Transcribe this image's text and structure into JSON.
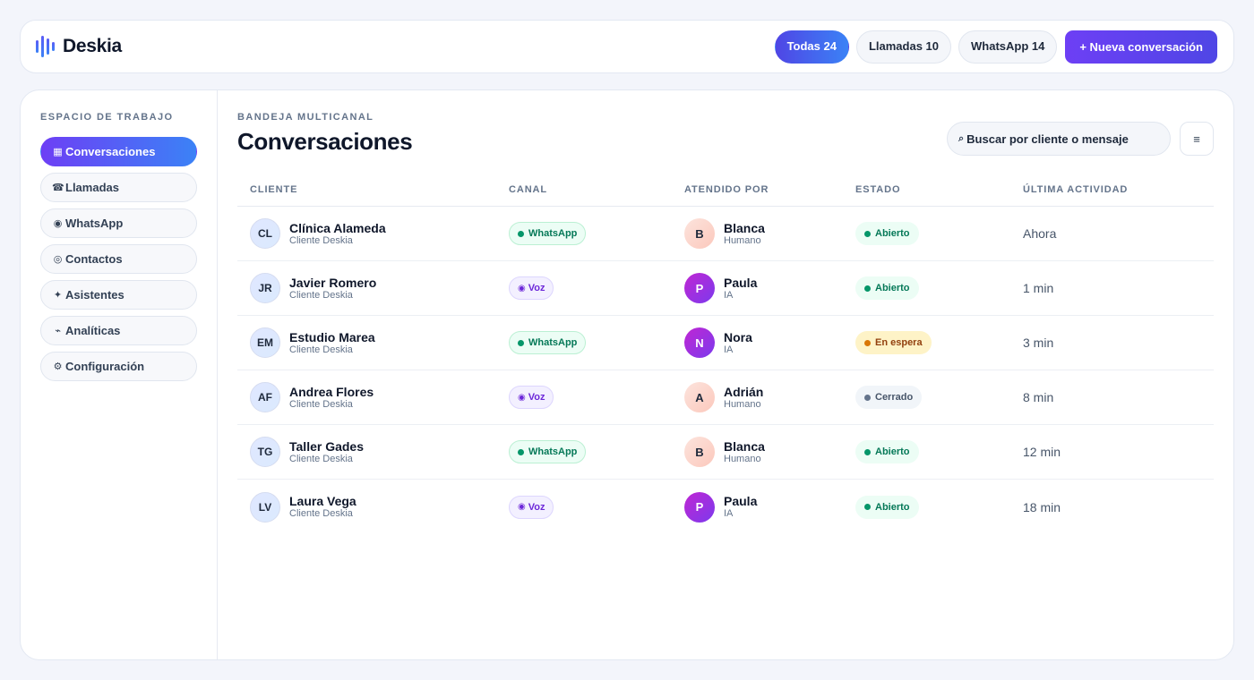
{
  "app": {
    "name": "Deskia"
  },
  "topbar": {
    "filters": [
      {
        "label": "Todas 24",
        "active": true
      },
      {
        "label": "Llamadas 10",
        "active": false
      },
      {
        "label": "WhatsApp 14",
        "active": false
      }
    ],
    "new_conversation_label": "+ Nueva conversación"
  },
  "sidebar": {
    "section_title": "ESPACIO DE TRABAJO",
    "items": [
      {
        "icon": "▦",
        "icon_name": "grid-icon",
        "label": "Conversaciones",
        "active": true
      },
      {
        "icon": "☎",
        "icon_name": "phone-icon",
        "label": "Llamadas",
        "active": false
      },
      {
        "icon": "◉",
        "icon_name": "whatsapp-icon",
        "label": "WhatsApp",
        "active": false
      },
      {
        "icon": "◎",
        "icon_name": "contacts-icon",
        "label": "Contactos",
        "active": false
      },
      {
        "icon": "✦",
        "icon_name": "sparkle-icon",
        "label": "Asistentes",
        "active": false
      },
      {
        "icon": "⌁",
        "icon_name": "analytics-icon",
        "label": "Analíticas",
        "active": false
      },
      {
        "icon": "⚙",
        "icon_name": "gear-icon",
        "label": "Configuración",
        "active": false
      }
    ]
  },
  "main": {
    "eyebrow": "BANDEJA MULTICANAL",
    "title": "Conversaciones",
    "search": {
      "icon": "⌕",
      "text": "Buscar por cliente o mensaje"
    },
    "filter_icon": "≡"
  },
  "table": {
    "columns": [
      "CLIENTE",
      "CANAL",
      "ATENDIDO POR",
      "ESTADO",
      "ÚLTIMA ACTIVIDAD"
    ],
    "rows": [
      {
        "initials": "CL",
        "client": "Clínica Alameda",
        "client_sub": "Cliente Deskia",
        "channel": "WhatsApp",
        "channel_type": "wa",
        "agent_initial": "B",
        "agent": "Blanca",
        "agent_role": "Humano",
        "agent_type": "human",
        "status": "Abierto",
        "status_type": "open",
        "activity": "Ahora"
      },
      {
        "initials": "JR",
        "client": "Javier Romero",
        "client_sub": "Cliente Deskia",
        "channel": "Voz",
        "channel_type": "voz",
        "agent_initial": "P",
        "agent": "Paula",
        "agent_role": "IA",
        "agent_type": "ia",
        "status": "Abierto",
        "status_type": "open",
        "activity": "1 min"
      },
      {
        "initials": "EM",
        "client": "Estudio Marea",
        "client_sub": "Cliente Deskia",
        "channel": "WhatsApp",
        "channel_type": "wa",
        "agent_initial": "N",
        "agent": "Nora",
        "agent_role": "IA",
        "agent_type": "ia",
        "status": "En espera",
        "status_type": "wait",
        "activity": "3 min"
      },
      {
        "initials": "AF",
        "client": "Andrea Flores",
        "client_sub": "Cliente Deskia",
        "channel": "Voz",
        "channel_type": "voz",
        "agent_initial": "A",
        "agent": "Adrián",
        "agent_role": "Humano",
        "agent_type": "human",
        "status": "Cerrado",
        "status_type": "closed",
        "activity": "8 min"
      },
      {
        "initials": "TG",
        "client": "Taller Gades",
        "client_sub": "Cliente Deskia",
        "channel": "WhatsApp",
        "channel_type": "wa",
        "agent_initial": "B",
        "agent": "Blanca",
        "agent_role": "Humano",
        "agent_type": "human",
        "status": "Abierto",
        "status_type": "open",
        "activity": "12 min"
      },
      {
        "initials": "LV",
        "client": "Laura Vega",
        "client_sub": "Cliente Deskia",
        "channel": "Voz",
        "channel_type": "voz",
        "agent_initial": "P",
        "agent": "Paula",
        "agent_role": "IA",
        "agent_type": "ia",
        "status": "Abierto",
        "status_type": "open",
        "activity": "18 min"
      }
    ]
  },
  "colors": {
    "accent": "#4f46e5",
    "accent_blue": "#3b82f6",
    "success": "#047857",
    "warning": "#92400e"
  }
}
